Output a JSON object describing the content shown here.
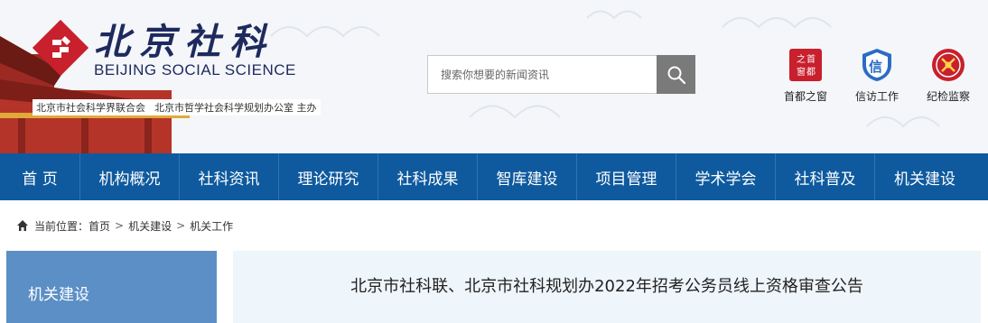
{
  "header": {
    "logo_cn": "北京社科",
    "logo_en": "BEIJING SOCIAL SCIENCE",
    "hosts": [
      "北京市社会科学界联合会",
      "北京市哲学社会科学规划办公室 主办"
    ],
    "search": {
      "placeholder": "搜索你想要的新闻资讯"
    },
    "quick_links": [
      {
        "label": "首都之窗",
        "icon": "capital-window-icon"
      },
      {
        "label": "信访工作",
        "icon": "petition-icon"
      },
      {
        "label": "纪检监察",
        "icon": "discipline-icon"
      }
    ]
  },
  "nav": {
    "items": [
      "首 页",
      "机构概况",
      "社科资讯",
      "理论研究",
      "社科成果",
      "智库建设",
      "项目管理",
      "学术学会",
      "社科普及",
      "机关建设"
    ]
  },
  "breadcrumb": {
    "prefix": "当前位置：",
    "items": [
      "首页",
      "机关建设",
      "机关工作"
    ]
  },
  "sidebar": {
    "title": "机关建设"
  },
  "article": {
    "title": "北京市社科联、北京市社科规划办2022年招考公务员线上资格审查公告"
  },
  "colors": {
    "nav": "#0f5a9e",
    "sidebar": "#5b8fc6",
    "logo_red": "#c8202c",
    "logo_text": "#1e2a5e"
  }
}
